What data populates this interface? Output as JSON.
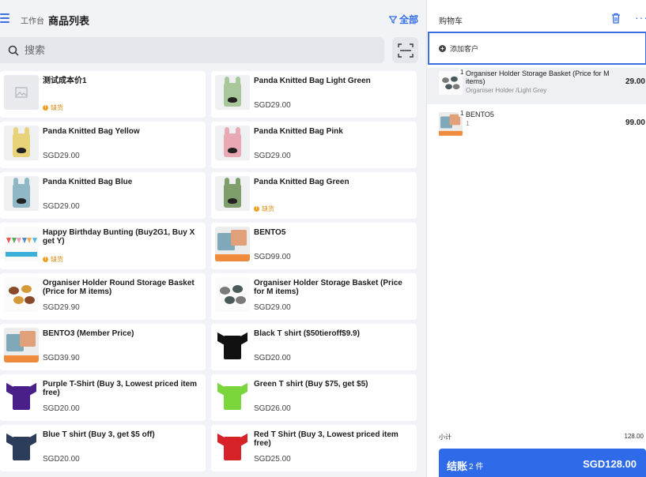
{
  "header": {
    "breadcrumb": "工作台",
    "title": "商品列表",
    "filter_label": "全部"
  },
  "search": {
    "placeholder": "搜索"
  },
  "colors": {
    "accent": "#2f6be8",
    "out_of_stock": "#f0a020",
    "background": "#f2f3f7"
  },
  "products": [
    {
      "name": "测试成本价1",
      "price": "",
      "status": "缺货",
      "thumb": "empty"
    },
    {
      "name": "Panda Knitted Bag Light Green",
      "price": "SGD29.00",
      "status": "",
      "thumb": "bag-lightgreen"
    },
    {
      "name": "Panda Knitted Bag Yellow",
      "price": "SGD29.00",
      "status": "",
      "thumb": "bag-yellow"
    },
    {
      "name": "Panda Knitted Bag Pink",
      "price": "SGD29.00",
      "status": "",
      "thumb": "bag-pink"
    },
    {
      "name": "Panda Knitted Bag Blue",
      "price": "SGD29.00",
      "status": "",
      "thumb": "bag-blue"
    },
    {
      "name": "Panda Knitted Bag Green",
      "price": "",
      "status": "缺货",
      "thumb": "bag-green"
    },
    {
      "name": "Happy Birthday Bunting (Buy2G1, Buy X get Y)",
      "price": "",
      "status": "缺货",
      "thumb": "bunting"
    },
    {
      "name": "BENTO5",
      "price": "SGD99.00",
      "status": "",
      "thumb": "bento"
    },
    {
      "name": "Organiser Holder Round Storage Basket (Price for M items)",
      "price": "SGD29.90",
      "status": "",
      "thumb": "baskets"
    },
    {
      "name": "Organiser Holder Storage Basket (Price for M items)",
      "price": "SGD29.00",
      "status": "",
      "thumb": "baskets-grey"
    },
    {
      "name": "BENTO3 (Member Price)",
      "price": "SGD39.90",
      "status": "",
      "thumb": "bento"
    },
    {
      "name": "Black T shirt ($50tieroff$9.9)",
      "price": "SGD20.00",
      "status": "",
      "thumb": "tshirt-black"
    },
    {
      "name": "Purple T-Shirt (Buy 3, Lowest priced item free)",
      "price": "SGD20.00",
      "status": "",
      "thumb": "tshirt-purple"
    },
    {
      "name": "Green T shirt (Buy $75, get $5)",
      "price": "SGD26.00",
      "status": "",
      "thumb": "tshirt-green"
    },
    {
      "name": "Blue T shirt (Buy 3, get $5 off)",
      "price": "SGD20.00",
      "status": "",
      "thumb": "tshirt-navy"
    },
    {
      "name": "Red T Shirt (Buy 3, Lowest priced item free)",
      "price": "SGD25.00",
      "status": "",
      "thumb": "tshirt-red"
    }
  ],
  "cart": {
    "title": "购物车",
    "add_customer": "添加客户",
    "items": [
      {
        "qty": "1",
        "name": "Organiser Holder Storage Basket (Price for M items)",
        "variant": "Organiser Holder /Light Grey",
        "price": "29.00",
        "thumb": "baskets-grey"
      },
      {
        "qty": "1",
        "name": "BENTO5",
        "variant": "1",
        "price": "99.00",
        "thumb": "bento"
      }
    ],
    "subtotal_label": "小计",
    "subtotal_value": "128.00",
    "checkout_label": "结账",
    "checkout_count": "2 件",
    "checkout_amount": "SGD128.00"
  }
}
